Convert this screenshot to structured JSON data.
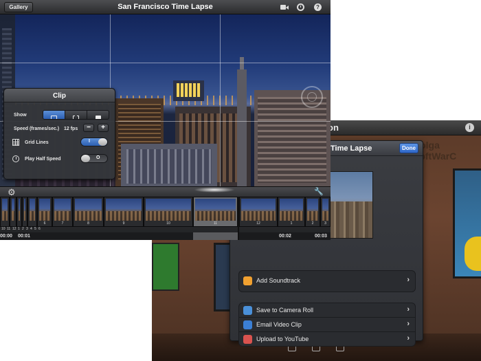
{
  "editor": {
    "title": "San Francisco Time Lapse",
    "gallery_label": "Gallery",
    "icons": {
      "video": "video-camera-icon",
      "clock": "clock-icon",
      "help": "help-icon"
    }
  },
  "clip_panel": {
    "title": "Clip",
    "show_label": "Show",
    "show_options": [
      "frames",
      "split-frames",
      "video"
    ],
    "show_selected": "frames",
    "speed_label": "Speed (frames/sec.)",
    "speed_value": "12 fps",
    "minus_label": "−",
    "plus_label": "+",
    "grid_lines_label": "Grid Lines",
    "grid_lines_on": true,
    "grid_lines_glyph": "I",
    "half_speed_label": "Play Half Speed",
    "half_speed_on": false,
    "half_speed_glyph": "O"
  },
  "timeline": {
    "tick_numbers": [
      "10",
      "11",
      "12",
      "1",
      "2",
      "3",
      "4",
      "5",
      "6"
    ],
    "frame_numbers": [
      "6",
      "7",
      "8",
      "9",
      "10",
      "11",
      "12",
      "1",
      "2",
      "3"
    ],
    "selected_frame": "11",
    "time_labels": [
      "00:00",
      "00:01",
      "00:02",
      "00:03"
    ]
  },
  "share_sheet": {
    "header_title_fragment": "on",
    "panel_title": "Time Lapse",
    "done_label": "Done",
    "watermark": "Bolga ЅoftWarC",
    "rows_top": [
      {
        "label": "Add Soundtrack",
        "icon": "music-note-icon",
        "icon_color": "#f0a030"
      }
    ],
    "rows_export": [
      {
        "label": "Save to Camera Roll",
        "icon": "camera-roll-icon",
        "icon_color": "#4a90d9"
      },
      {
        "label": "Email Video Clip",
        "icon": "email-icon",
        "icon_color": "#3b7fd4"
      },
      {
        "label": "Upload to YouTube",
        "icon": "youtube-icon",
        "icon_color": "#d9534f"
      }
    ]
  }
}
